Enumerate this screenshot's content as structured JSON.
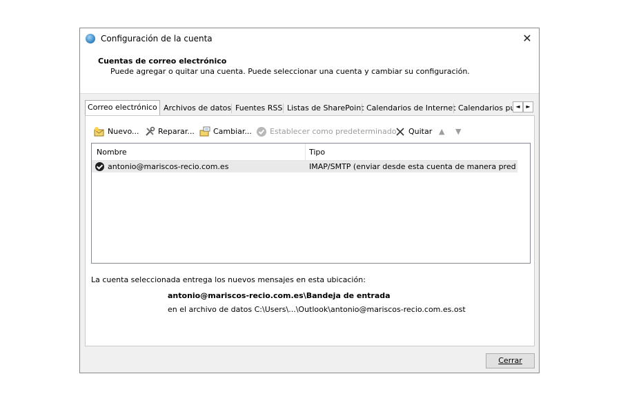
{
  "window": {
    "title": "Configuración de la cuenta",
    "close_glyph": "✕"
  },
  "header": {
    "title": "Cuentas de correo electrónico",
    "subtitle": "Puede agregar o quitar una cuenta. Puede seleccionar una cuenta y cambiar su configuración."
  },
  "tabs": [
    {
      "label": "Correo electrónico",
      "active": true
    },
    {
      "label": "Archivos de datos"
    },
    {
      "label": "Fuentes RSS"
    },
    {
      "label": "Listas de SharePoint"
    },
    {
      "label": "Calendarios de Internet"
    },
    {
      "label": "Calendarios pul"
    }
  ],
  "tab_scroll": {
    "left": "◄",
    "right": "►"
  },
  "toolbar": {
    "new": "Nuevo...",
    "repair": "Reparar...",
    "change": "Cambiar...",
    "set_default": "Establecer como predeterminado",
    "remove": "Quitar",
    "up_glyph": "▲",
    "down_glyph": "▼"
  },
  "table": {
    "headers": {
      "name": "Nombre",
      "type": "Tipo"
    },
    "rows": [
      {
        "name": "antonio@mariscos-recio.com.es",
        "type": "IMAP/SMTP (enviar desde esta cuenta de manera predet..."
      }
    ]
  },
  "delivery": {
    "label": "La cuenta seleccionada entrega los nuevos mensajes en esta ubicación:",
    "location": "antonio@mariscos-recio.com.es\\Bandeja de entrada",
    "file": "en el archivo de datos C:\\Users\\...\\Outlook\\antonio@mariscos-recio.com.es.ost"
  },
  "footer": {
    "close_label": "Cerrar"
  }
}
